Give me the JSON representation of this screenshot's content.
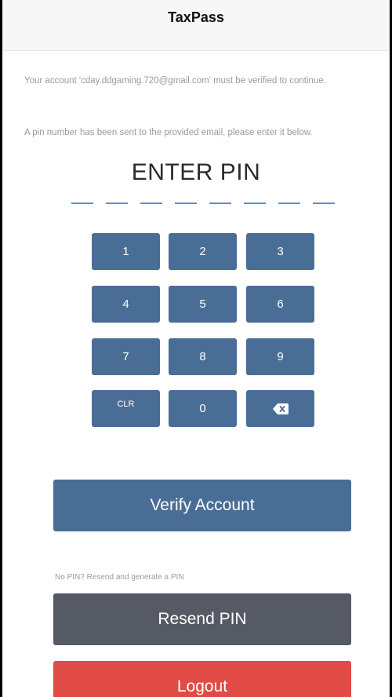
{
  "nav": {
    "title": "TaxPass"
  },
  "messages": {
    "verify_notice": "Your account 'cday.ddgaming.720@gmail.com' must be verified to continue.",
    "pin_sent_notice": "A pin number has been sent to the provided email, please enter it below."
  },
  "pin_entry": {
    "heading": "ENTER PIN",
    "slot_count": 8,
    "slot_color": "#5b8fc7"
  },
  "keypad": {
    "keys": [
      "1",
      "2",
      "3",
      "4",
      "5",
      "6",
      "7",
      "8",
      "9",
      "CLR",
      "0"
    ],
    "backspace_icon": "backspace-icon",
    "key_color": "#4a6d96"
  },
  "actions": {
    "verify_label": "Verify Account",
    "resend_hint": "No PIN? Resend and generate a PIN",
    "resend_label": "Resend PIN",
    "logout_label": "Logout"
  },
  "colors": {
    "primary": "#4a6d96",
    "secondary": "#555a65",
    "danger": "#e14b45"
  }
}
